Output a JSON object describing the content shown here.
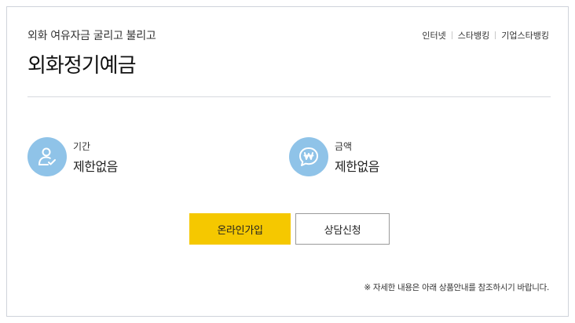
{
  "product": {
    "subtitle": "외화 여유자금 굴리고 불리고",
    "title": "외화정기예금"
  },
  "channels": [
    "인터넷",
    "스타뱅킹",
    "기업스타뱅킹"
  ],
  "info": {
    "period": {
      "icon": "person-check-icon",
      "label": "기간",
      "value": "제한없음"
    },
    "amount": {
      "icon": "won-chat-icon",
      "label": "금액",
      "value": "제한없음"
    }
  },
  "buttons": {
    "join": "온라인가입",
    "consult": "상담신청"
  },
  "notice": "※ 자세한 내용은 아래 상품안내를 참조하시기 바랍니다.",
  "colors": {
    "accent": "#f5c800",
    "icon_bg": "#8fc3e8",
    "border": "#cfd3da"
  }
}
